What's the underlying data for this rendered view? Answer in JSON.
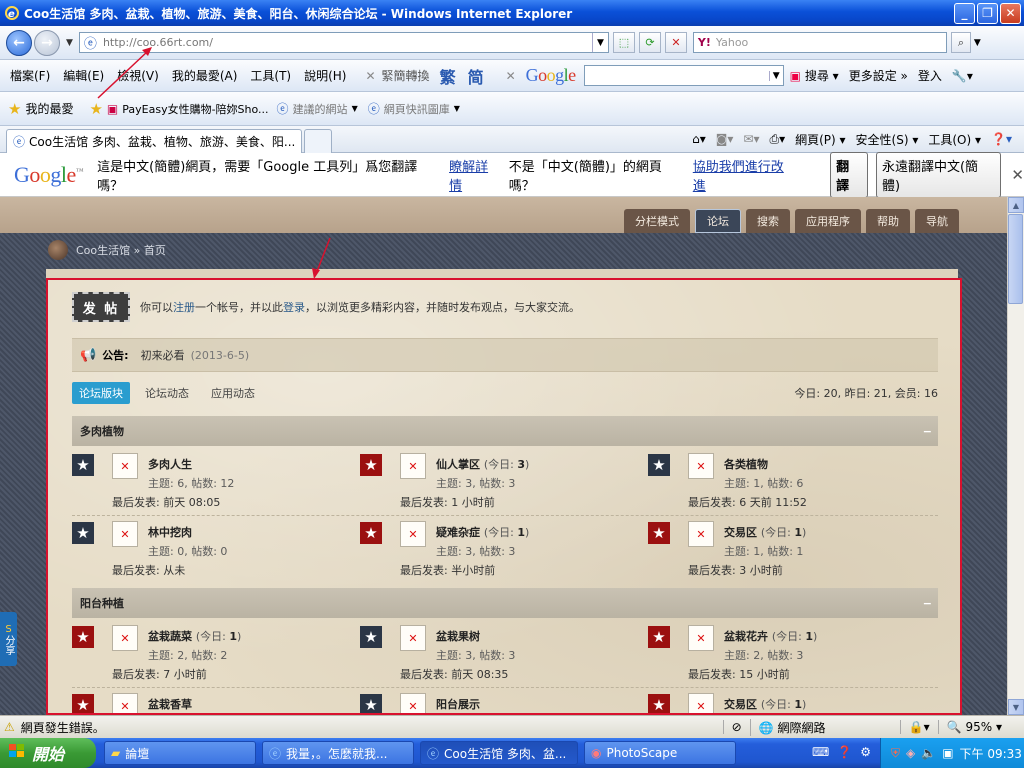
{
  "window": {
    "title": "Coo生活馆 多肉、盆栽、植物、旅游、美食、阳台、休闲综合论坛 - Windows Internet Explorer"
  },
  "addressbar": {
    "url": "http://coo.66rt.com/",
    "search_placeholder": "Yahoo",
    "search_brand": "Y!"
  },
  "menu": {
    "items": [
      "檔案(F)",
      "編輯(E)",
      "檢視(V)",
      "我的最愛(A)",
      "工具(T)",
      "說明(H)"
    ],
    "convert_label": "緊簡轉換",
    "trad": "繁",
    "simp": "简",
    "google_search": "搜尋",
    "more_settings": "更多設定",
    "login": "登入"
  },
  "favorites": {
    "label": "我的最愛",
    "items": [
      "PayEasy女性購物-陪妳Sho...",
      "建議的網站",
      "網頁快訊圖庫"
    ]
  },
  "tabs": {
    "active": "Coo生活馆 多肉、盆栽、植物、旅游、美食、阳...",
    "commands": [
      "網頁(P)",
      "安全性(S)",
      "工具(O)"
    ]
  },
  "translate": {
    "message": "這是中文(簡體)網頁，需要「Google 工具列」爲您翻譯嗎？",
    "learn_more": "瞭解詳情",
    "not_prefix": "不是「中文(簡體)」的網頁嗎？",
    "help_link": "協助我們進行改進",
    "translate_btn": "翻譯",
    "always_btn": "永遠翻譯中文(簡體)"
  },
  "site": {
    "nav": [
      "分栏模式",
      "论坛",
      "搜索",
      "应用程序",
      "帮助",
      "导航"
    ],
    "breadcrumb": "Coo生活馆 » 首页",
    "post_button": "发 帖",
    "intro_a": "你可以",
    "intro_register": "注册",
    "intro_b": "一个帐号，并以此",
    "intro_login": "登录",
    "intro_c": "，以浏览更多精彩内容，并随时发布观点，与大家交流。",
    "notice_label": "公告:",
    "notice_text": "初来必看",
    "notice_date": "(2013-6-5)",
    "subtabs": [
      "论坛版块",
      "论坛动态",
      "应用动态"
    ],
    "stats": "今日: 20, 昨日: 21, 会员: 16",
    "sections": [
      {
        "title": "多肉植物",
        "collapse": "−",
        "forums": [
          {
            "name": "多肉人生",
            "today": "",
            "stats": "主题: 6, 帖数: 12",
            "last": "最后发表: 前天 08:05",
            "star": "navy"
          },
          {
            "name": "仙人掌区",
            "today": "3",
            "stats": "主题: 3, 帖数: 3",
            "last": "最后发表: 1 小时前",
            "star": "red"
          },
          {
            "name": "各类植物",
            "today": "",
            "stats": "主题: 1, 帖数: 6",
            "last": "最后发表: 6 天前 11:52",
            "star": "navy"
          },
          {
            "name": "林中挖肉",
            "today": "",
            "stats": "主题: 0, 帖数: 0",
            "last": "最后发表: 从未",
            "star": "navy"
          },
          {
            "name": "疑难杂症",
            "today": "1",
            "stats": "主题: 3, 帖数: 3",
            "last": "最后发表: 半小时前",
            "star": "red"
          },
          {
            "name": "交易区",
            "today": "1",
            "stats": "主题: 1, 帖数: 1",
            "last": "最后发表: 3 小时前",
            "star": "red"
          }
        ]
      },
      {
        "title": "阳台种植",
        "collapse": "−",
        "forums": [
          {
            "name": "盆栽蔬菜",
            "today": "1",
            "stats": "主题: 2, 帖数: 2",
            "last": "最后发表: 7 小时前",
            "star": "red"
          },
          {
            "name": "盆栽果树",
            "today": "",
            "stats": "主题: 3, 帖数: 3",
            "last": "最后发表: 前天 08:35",
            "star": "navy"
          },
          {
            "name": "盆栽花卉",
            "today": "1",
            "stats": "主题: 2, 帖数: 3",
            "last": "最后发表: 15 小时前",
            "star": "red"
          },
          {
            "name": "盆栽香草",
            "today": "",
            "stats": "",
            "last": "",
            "star": "red"
          },
          {
            "name": "阳台展示",
            "today": "",
            "stats": "",
            "last": "",
            "star": "navy"
          },
          {
            "name": "交易区",
            "today": "1",
            "stats": "",
            "last": "",
            "star": "red"
          }
        ]
      }
    ],
    "share": "分享"
  },
  "status": {
    "left": "網頁發生錯誤。",
    "zone": "網際網路",
    "zoom": "95%"
  },
  "taskbar": {
    "start": "開始",
    "tasks": [
      "論壇",
      "我量，。怎麼就我...",
      "Coo生活馆 多肉、盆...",
      "PhotoScape"
    ],
    "clock": "下午 09:33"
  }
}
